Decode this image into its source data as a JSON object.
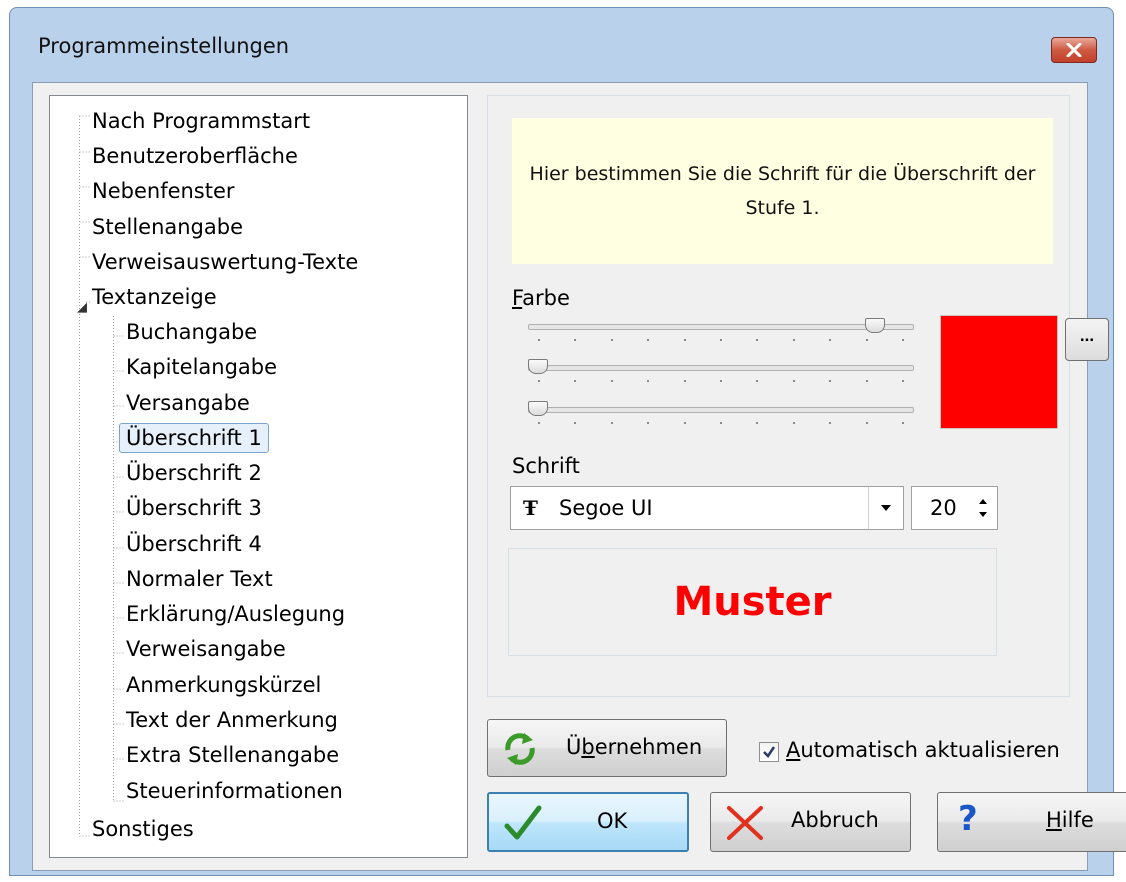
{
  "window": {
    "title": "Programmeinstellungen",
    "close_icon": "close-x-icon"
  },
  "tree": {
    "items": [
      {
        "label": "Nach Programmstart",
        "level": 0
      },
      {
        "label": "Benutzeroberfläche",
        "level": 0
      },
      {
        "label": "Nebenfenster",
        "level": 0
      },
      {
        "label": "Stellenangabe",
        "level": 0
      },
      {
        "label": "Verweisauswertung-Texte",
        "level": 0
      },
      {
        "label": "Textanzeige",
        "level": 0,
        "expanded": true
      },
      {
        "label": "Buchangabe",
        "level": 1
      },
      {
        "label": "Kapitelangabe",
        "level": 1
      },
      {
        "label": "Versangabe",
        "level": 1
      },
      {
        "label": "Überschrift 1",
        "level": 1,
        "selected": true
      },
      {
        "label": "Überschrift 2",
        "level": 1
      },
      {
        "label": "Überschrift 3",
        "level": 1
      },
      {
        "label": "Überschrift 4",
        "level": 1
      },
      {
        "label": "Normaler Text",
        "level": 1
      },
      {
        "label": "Erklärung/Auslegung",
        "level": 1
      },
      {
        "label": "Verweisangabe",
        "level": 1
      },
      {
        "label": "Anmerkungskürzel",
        "level": 1
      },
      {
        "label": "Text der Anmerkung",
        "level": 1
      },
      {
        "label": "Extra Stellenangabe",
        "level": 1
      },
      {
        "label": "Steuerinformationen",
        "level": 1
      },
      {
        "label": "Sonstiges",
        "level": 0
      }
    ]
  },
  "info": {
    "text": "Hier bestimmen Sie die Schrift für die Überschrift der Stufe 1."
  },
  "color": {
    "label_prefix": "F",
    "label_rest": "arbe",
    "sliders": [
      {
        "channel": "red",
        "value": 0.92
      },
      {
        "channel": "green",
        "value": 0.0
      },
      {
        "channel": "blue",
        "value": 0.0
      }
    ],
    "swatch": "#ff0000",
    "more_button": "..."
  },
  "font": {
    "label": "Schrift",
    "family": "Segoe UI",
    "size": "20"
  },
  "preview": {
    "text": "Muster",
    "color": "#ff0000"
  },
  "apply": {
    "label_prefix": "Ü",
    "label_mnemonic": "b",
    "label_rest": "ernehmen"
  },
  "auto_update": {
    "checked": true,
    "label_mnemonic": "A",
    "label_rest": "utomatisch aktualisieren"
  },
  "buttons": {
    "ok": "OK",
    "cancel": "Abbruch",
    "help_mnemonic": "H",
    "help_rest": "ilfe"
  }
}
